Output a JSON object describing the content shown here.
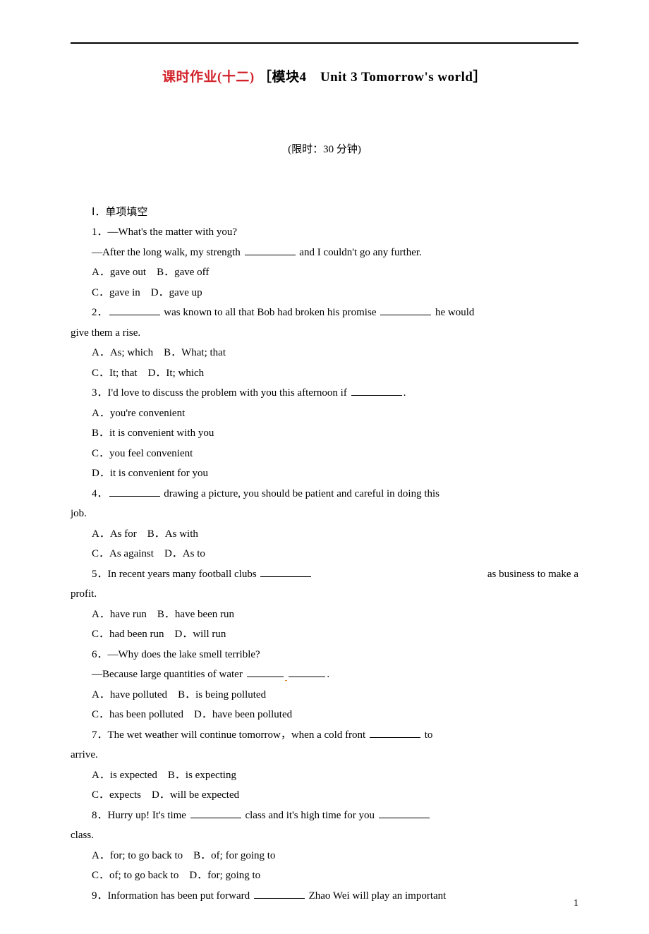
{
  "title_red": "课时作业(十二)",
  "title_black": "［模块4　Unit 3 Tomorrow's world］",
  "time_limit": "(限时：30 分钟)",
  "section_heading": "Ⅰ．单项填空",
  "q1": {
    "line1": "1．—What's the matter with you?",
    "line2a": "—After the long walk, my strength ",
    "line2b": " and I couldn't go any further.",
    "optA": "A．gave out",
    "optB": "B．gave off",
    "optC": "C．gave in",
    "optD": "D．gave up"
  },
  "q2": {
    "line1a": "2．",
    "line1b": " was known to all that Bob had broken his promise ",
    "line1c": " he would",
    "line2": "give them a rise.",
    "optA": "A．As; which",
    "optB": "B．What; that",
    "optC": "C．It; that",
    "optD": "D．It; which"
  },
  "q3": {
    "line1a": "3．I'd love to discuss the problem with you this afternoon if ",
    "line1b": ".",
    "optA": "A．you're convenient",
    "optB": "B．it is convenient with you",
    "optC": "C．you feel convenient",
    "optD": "D．it is convenient for you"
  },
  "q4": {
    "line1a": "4．",
    "line1b": " drawing a picture, you should be patient and careful in doing this",
    "line2": "job.",
    "optA": "A．As for",
    "optB": "B．As with",
    "optC": "C．As against",
    "optD": "D．As to"
  },
  "q5": {
    "line1a": "5．In recent years many football clubs ",
    "line1b": " as business to make a",
    "line2": "profit.",
    "optA": "A．have run",
    "optB": "B．have been run",
    "optC": "C．had been run",
    "optD": "D．will run"
  },
  "q6": {
    "line1": "6．—Why does the lake smell terrible?",
    "line2a": "—Because large quantities of water ",
    "line2b": ".",
    "optA": "A．have polluted",
    "optB": "B．is being polluted",
    "optC": "C．has been polluted",
    "optD": "D．have been polluted"
  },
  "q7": {
    "line1a": "7．The wet weather will continue tomorrow，when a cold front ",
    "line1b": " to",
    "line2": "arrive.",
    "optA": "A．is expected",
    "optB": "B．is expecting",
    "optC": "C．expects",
    "optD": "D．will be expected"
  },
  "q8": {
    "line1a": "8．Hurry up! It's time ",
    "line1b": " class and it's high time for you ",
    "line2": "class.",
    "optA": "A．for; to go back to",
    "optB": "B．of; for going to",
    "optC": "C．of; to go back to",
    "optD": "D．for; going to"
  },
  "q9": {
    "line1a": "9．Information has been put forward ",
    "line1b": " Zhao Wei will play an important"
  },
  "page_number": "1"
}
